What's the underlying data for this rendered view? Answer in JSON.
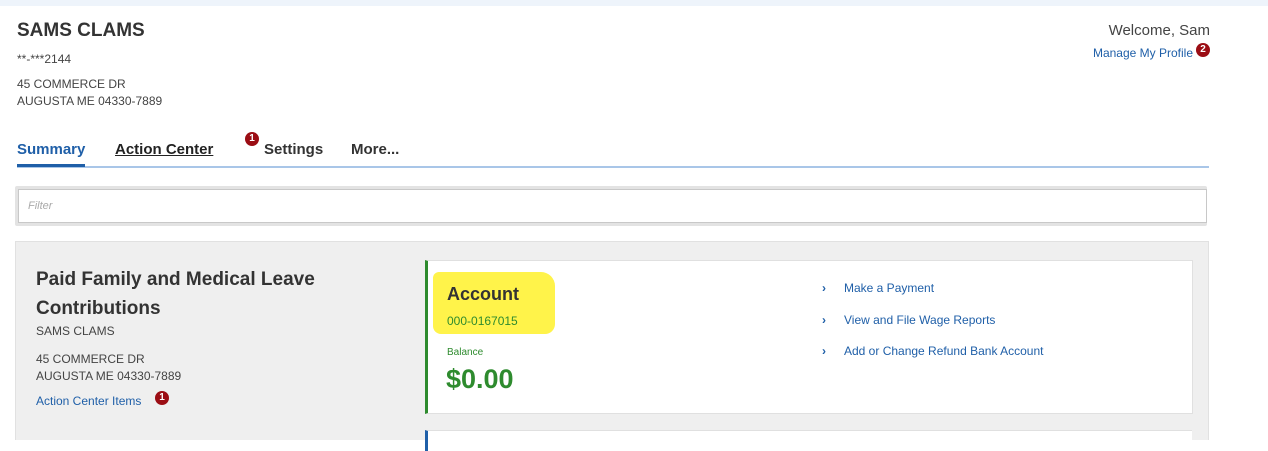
{
  "header": {
    "business_name": "SAMS CLAMS",
    "business_id": "**-***2144",
    "address_line1": "45 COMMERCE DR",
    "address_line2": "AUGUSTA ME 04330-7889",
    "welcome": "Welcome, Sam",
    "manage_profile": "Manage My Profile",
    "profile_badge": "2"
  },
  "tabs": {
    "summary": "Summary",
    "action_center": "Action Center",
    "action_center_badge": "1",
    "settings": "Settings",
    "more": "More..."
  },
  "filter": {
    "placeholder": "Filter"
  },
  "account_panel": {
    "title": "Paid Family and Medical Leave Contributions",
    "name": "SAMS CLAMS",
    "address_line1": "45 COMMERCE DR",
    "address_line2": "AUGUSTA ME 04330-7889",
    "action_items_link": "Action Center Items",
    "action_items_badge": "1"
  },
  "account_card": {
    "label": "Account",
    "number": "000-0167015",
    "balance_label": "Balance",
    "balance": "$0.00",
    "links": [
      "Make a Payment",
      "View and File Wage Reports",
      "Add or Change Refund Bank Account"
    ]
  },
  "colors": {
    "link": "#1f5fa8",
    "badge": "#9b0d14",
    "balance_green": "#2e8b2e",
    "highlight": "#fff34a"
  }
}
